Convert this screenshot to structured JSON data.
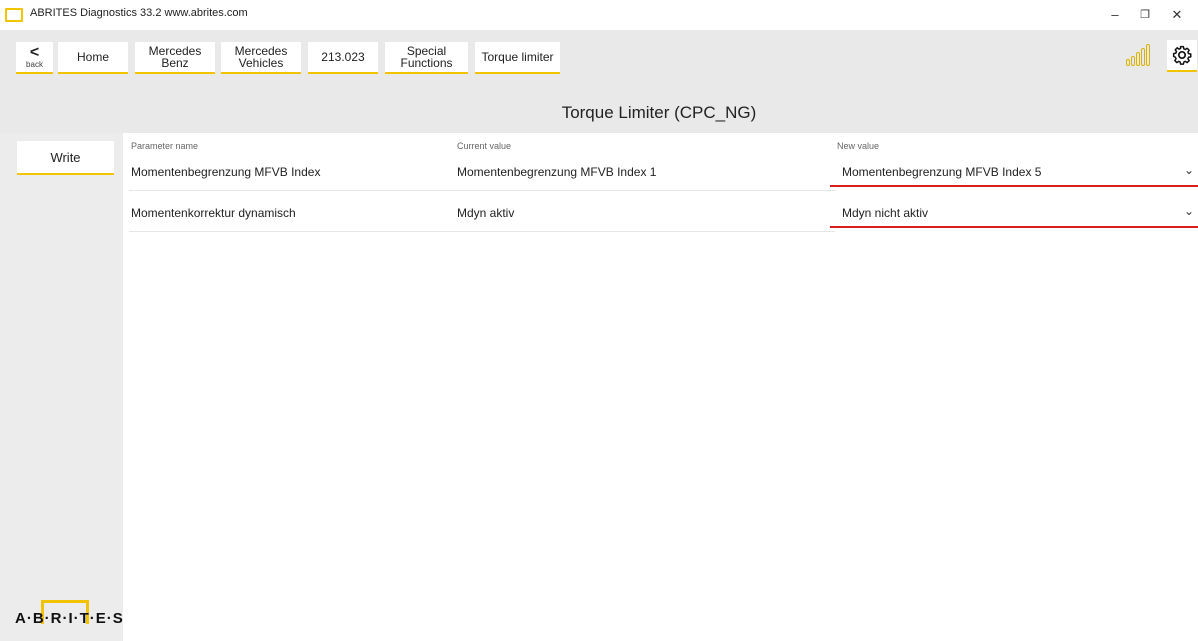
{
  "window": {
    "title": "ABRITES Diagnostics 33.2  www.abrites.com",
    "controls": {
      "minimize": "–",
      "restore": "❐",
      "close": "✕"
    }
  },
  "toolbar": {
    "back": {
      "arrow": "<",
      "label": "back"
    },
    "crumbs": [
      {
        "label": "Home"
      },
      {
        "label": "Mercedes\nBenz"
      },
      {
        "label": "Mercedes\nVehicles"
      },
      {
        "label": "213.023"
      },
      {
        "label": "Special\nFunctions"
      },
      {
        "label": "Torque limiter"
      }
    ],
    "signal_icon": "signal-strength-icon",
    "settings_icon": "gear-icon"
  },
  "page": {
    "title": "Torque Limiter (CPC_NG)"
  },
  "sidebar": {
    "write_label": "Write",
    "logo_text": "A·B·R·I·T·E·S"
  },
  "table": {
    "headers": {
      "name": "Parameter name",
      "current": "Current value",
      "new": "New value"
    },
    "rows": [
      {
        "name": "Momentenbegrenzung MFVB Index",
        "current": "Momentenbegrenzung MFVB Index 1",
        "new": "Momentenbegrenzung MFVB Index 5"
      },
      {
        "name": "Momentenkorrektur dynamisch",
        "current": "Mdyn aktiv",
        "new": "Mdyn nicht aktiv"
      }
    ]
  },
  "colors": {
    "accent": "#f2c400",
    "changed_underline": "#d81e1e",
    "toolbar_bg": "#e9e9e9"
  }
}
